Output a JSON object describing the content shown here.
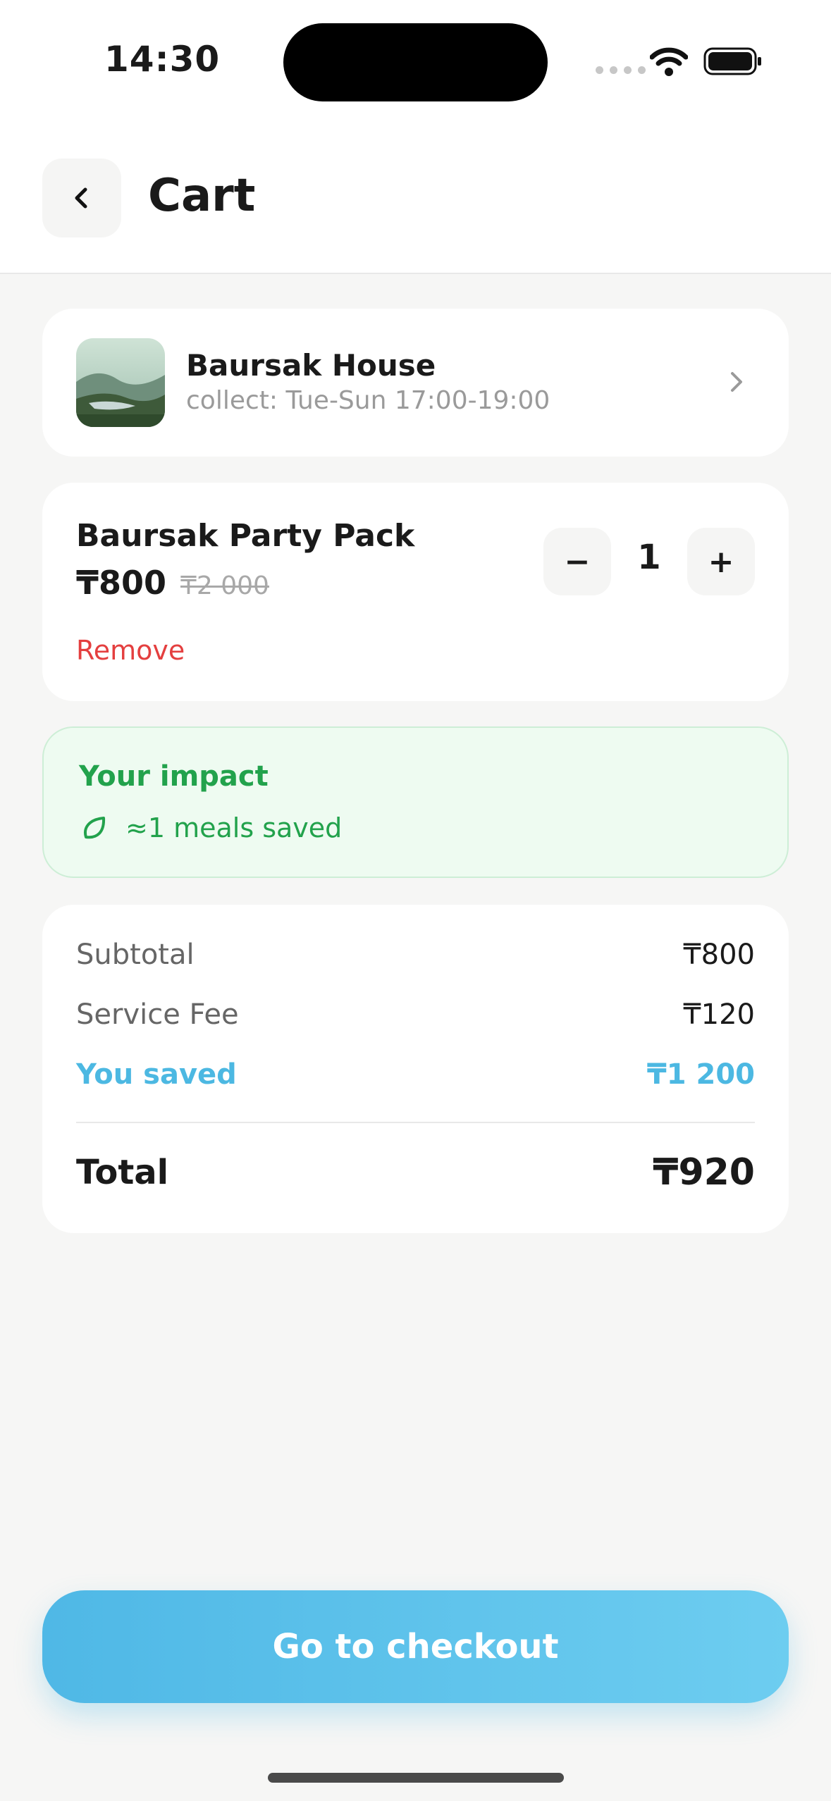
{
  "status_bar": {
    "time": "14:30"
  },
  "header": {
    "title": "Cart",
    "back_icon": "chevron-left-icon"
  },
  "store": {
    "name": "Baursak House",
    "hours": "collect: Tue-Sun 17:00-19:00",
    "chevron_icon": "chevron-right-icon"
  },
  "item": {
    "name": "Baursak Party Pack",
    "price": "₸800",
    "original_price": "₸2 000",
    "remove_label": "Remove",
    "quantity": "1",
    "minus_label": "−",
    "plus_label": "+"
  },
  "impact": {
    "title": "Your impact",
    "text": "≈1 meals saved",
    "icon": "leaf-icon"
  },
  "summary": {
    "subtotal_label": "Subtotal",
    "subtotal_value": "₸800",
    "fee_label": "Service Fee",
    "fee_value": "₸120",
    "saved_label": "You saved",
    "saved_value": "₸1 200",
    "total_label": "Total",
    "total_value": "₸920"
  },
  "checkout": {
    "label": "Go to checkout"
  },
  "colors": {
    "accent": "#4fb8e6",
    "saved": "#4cb8e2",
    "remove": "#e43f3f",
    "impact": "#22a24c",
    "impact_bg": "#eefbf1",
    "background": "#f6f6f5"
  }
}
